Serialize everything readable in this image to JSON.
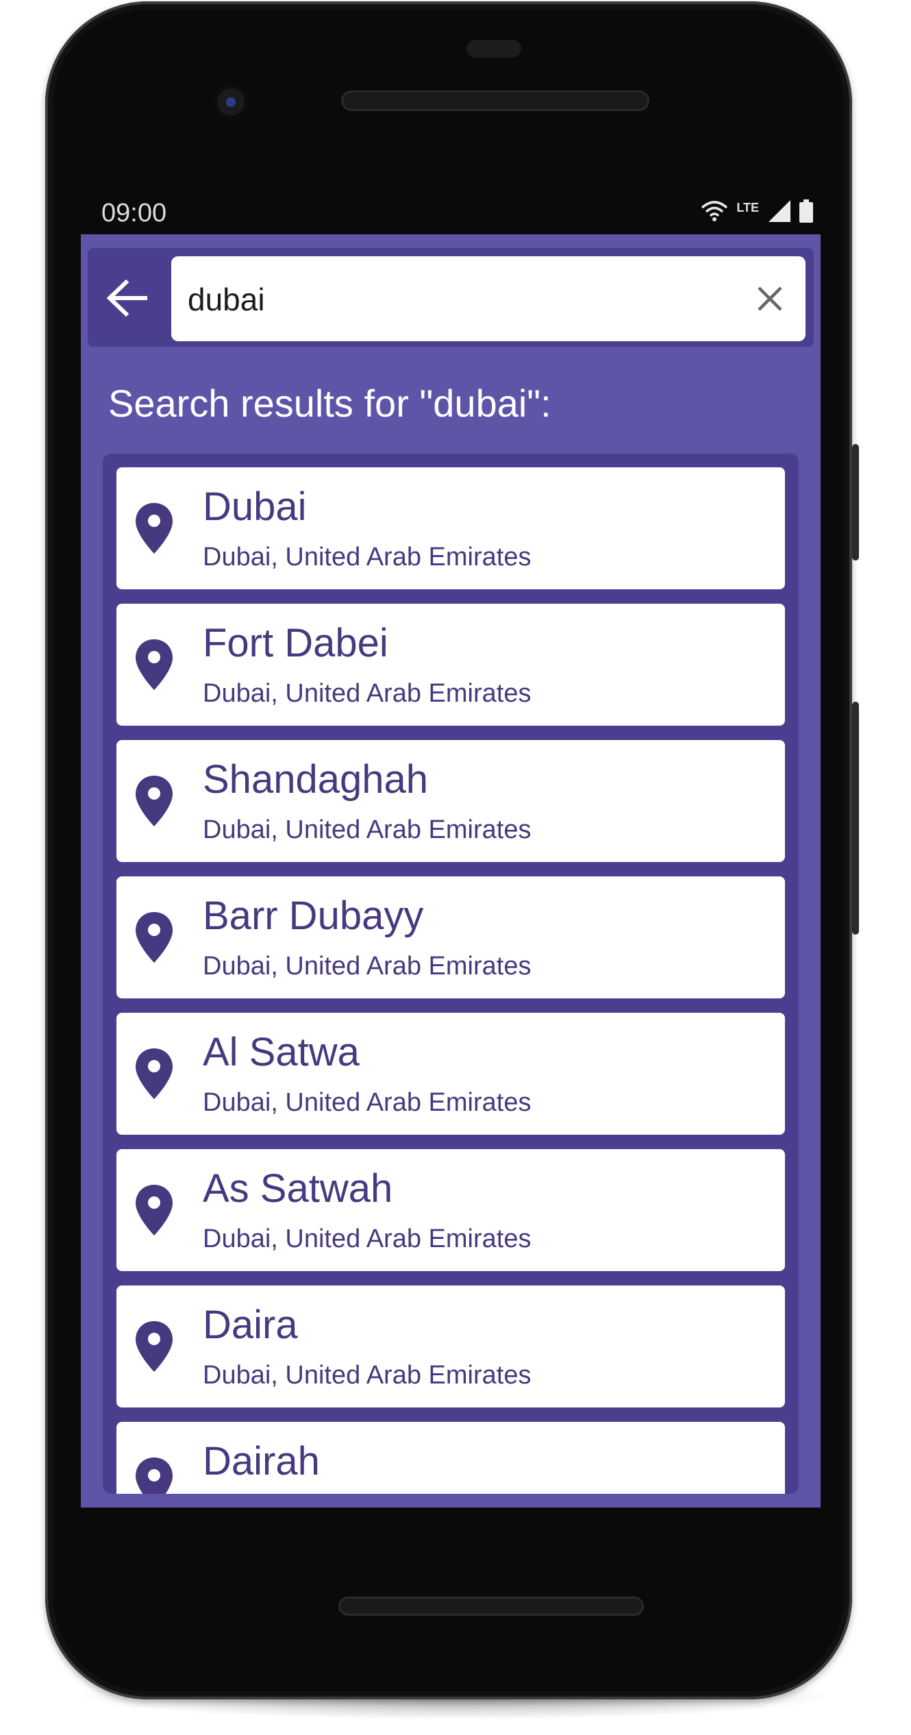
{
  "status_bar": {
    "time": "09:00",
    "network_label": "LTE",
    "icons": [
      "wifi-icon",
      "signal-icon",
      "battery-icon"
    ]
  },
  "toolbar": {
    "back_icon": "arrow-left-icon",
    "search_value": "dubai",
    "search_placeholder": "",
    "clear_icon": "close-icon"
  },
  "results": {
    "heading": "Search results for \"dubai\":",
    "items": [
      {
        "name": "Dubai",
        "region": "Dubai, United Arab Emirates",
        "icon": "map-pin-icon"
      },
      {
        "name": "Fort Dabei",
        "region": "Dubai, United Arab Emirates",
        "icon": "map-pin-icon"
      },
      {
        "name": "Shandaghah",
        "region": "Dubai, United Arab Emirates",
        "icon": "map-pin-icon"
      },
      {
        "name": "Barr Dubayy",
        "region": "Dubai, United Arab Emirates",
        "icon": "map-pin-icon"
      },
      {
        "name": "Al Satwa",
        "region": "Dubai, United Arab Emirates",
        "icon": "map-pin-icon"
      },
      {
        "name": "As Satwah",
        "region": "Dubai, United Arab Emirates",
        "icon": "map-pin-icon"
      },
      {
        "name": "Daira",
        "region": "Dubai, United Arab Emirates",
        "icon": "map-pin-icon"
      },
      {
        "name": "Dairah",
        "region": "",
        "icon": "map-pin-icon"
      }
    ]
  },
  "colors": {
    "screen_background": "#5f55a8",
    "panel_background": "#4a3f8e",
    "text_accent": "#47397f",
    "card_background": "#ffffff"
  }
}
